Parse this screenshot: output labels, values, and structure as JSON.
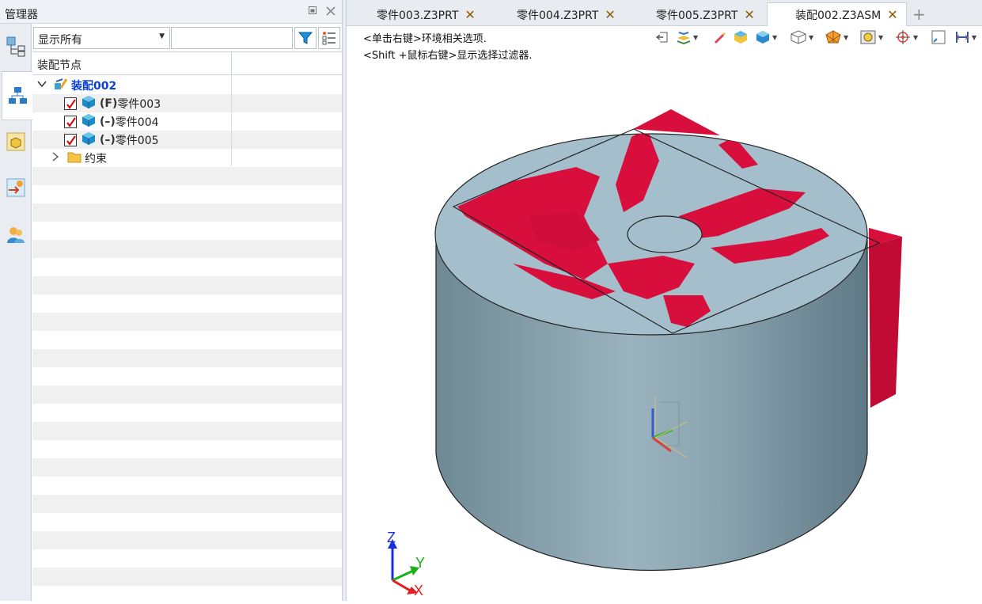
{
  "manager": {
    "title": "管理器",
    "filter_value": "显示所有",
    "search_placeholder": "",
    "column_header": "装配节点",
    "root": {
      "label": "装配002"
    },
    "parts": [
      {
        "prefix": "(F)",
        "name": "零件003",
        "checked": true
      },
      {
        "prefix": "(–)",
        "name": "零件004",
        "checked": true
      },
      {
        "prefix": "(–)",
        "name": "零件005",
        "checked": true
      }
    ],
    "constraints": {
      "label": "约束"
    }
  },
  "tabs": [
    {
      "label": "零件003.Z3PRT",
      "active": false
    },
    {
      "label": "零件004.Z3PRT",
      "active": false
    },
    {
      "label": "零件005.Z3PRT",
      "active": false
    },
    {
      "label": "装配002.Z3ASM",
      "active": true
    }
  ],
  "viewport": {
    "hint_line1": "<单击右键>环境相关选项.",
    "hint_line2": "<Shift +鼠标右键>显示选择过滤器.",
    "axis_labels": {
      "x": "X",
      "y": "Y",
      "z": "Z"
    }
  },
  "colors": {
    "accent_blue": "#0a3fd6",
    "part_grey": "#9fb8c4",
    "part_red": "#d80e3c",
    "tab_close": "#8a5a00"
  },
  "icons": [
    "panel-restore-icon",
    "panel-close-icon",
    "funnel-icon",
    "list-settings-icon",
    "expand-down-icon",
    "expand-right-icon",
    "assembly-icon",
    "part-cube-icon",
    "folder-icon",
    "checkbox-icon"
  ]
}
